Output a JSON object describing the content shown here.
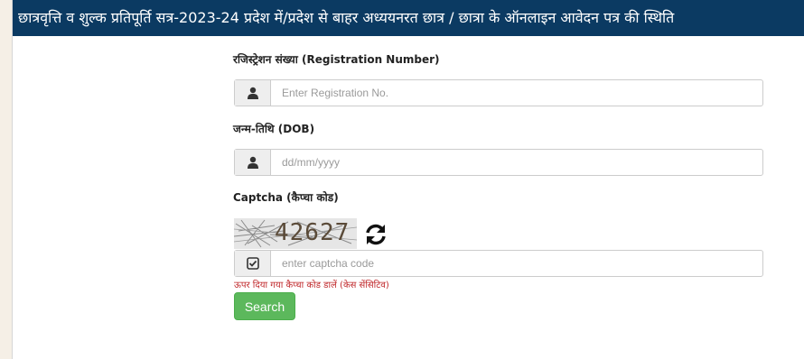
{
  "header": {
    "title": "छात्रवृत्ति व शुल्क प्रतिपूर्ति सत्र-2023-24 प्रदेश में/प्रदेश से बाहर अध्ययनरत छात्र / छात्रा के ऑनलाइन आवेदन पत्र की स्थिति"
  },
  "form": {
    "registration": {
      "label": "रजिस्ट्रेशन संख्या (Registration Number)",
      "placeholder": "Enter Registration No.",
      "value": "",
      "icon": "user-icon"
    },
    "dob": {
      "label": "जन्म-तिथि (DOB)",
      "placeholder": "dd/mm/yyyy",
      "value": "",
      "icon": "user-icon"
    },
    "captcha": {
      "label": "Captcha (कैप्चा कोड)",
      "code": "42627",
      "refresh_icon": "refresh-icon",
      "placeholder": "enter captcha code",
      "value": "",
      "icon": "check-square-icon",
      "hint": "ऊपर दिया गया कैप्चा कोड डालें (केस सेंसिटिव)"
    },
    "search_label": "Search"
  },
  "colors": {
    "header_bg": "#0b3a62",
    "button_bg": "#5cb85c",
    "hint_text": "#c0282b"
  }
}
